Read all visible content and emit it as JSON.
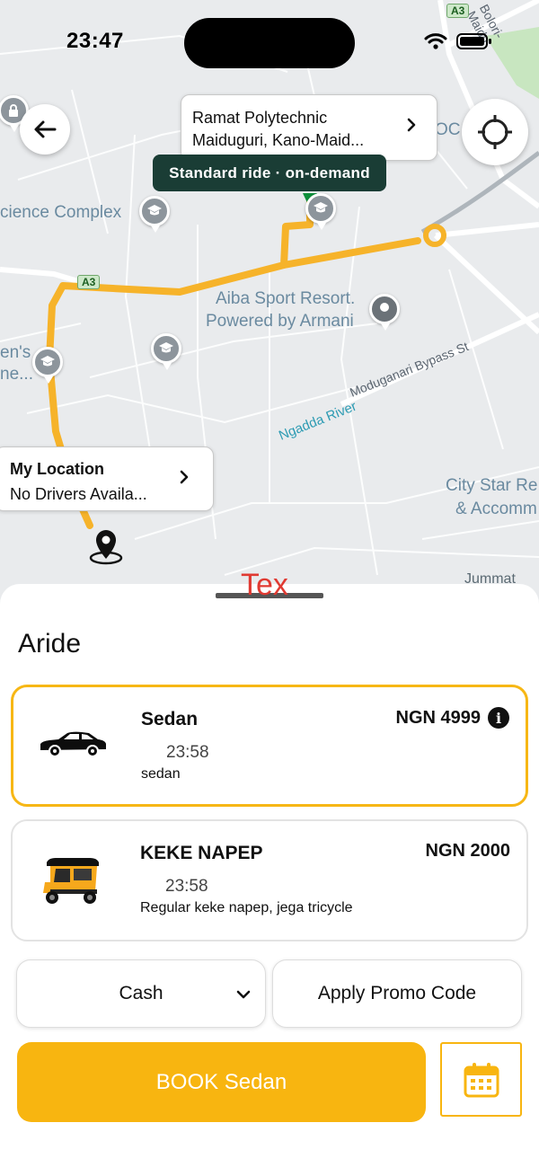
{
  "status_bar": {
    "time": "23:47"
  },
  "map": {
    "labels": {
      "science_complex": "cience Complex",
      "aiba_line1": "Aiba Sport Resort.",
      "aiba_line2": "Powered by Armani",
      "bypass": "Moduganari Bypass St",
      "river": "Ngadda River",
      "citystar_line1": "City Star Re",
      "citystar_line2": "& Accomm",
      "jummat": "Jummat",
      "ens_line1": "en's",
      "ens_line2": "ne...",
      "bolori": "Bolori-Maidu",
      "roc": "OC",
      "road_a3_top": "A3",
      "road_a3_left": "A3"
    },
    "destination": {
      "line1": "Ramat Polytechnic",
      "line2": "Maiduguri, Kano-Maid..."
    },
    "ride_tooltip": "Standard ride · on-demand",
    "my_location": {
      "title": "My Location",
      "subtitle": "No Drivers Availa..."
    }
  },
  "sheet": {
    "overlay_text": "Tex",
    "title": "Aride",
    "rides": [
      {
        "name": "Sedan",
        "time": "23:58",
        "description": "sedan",
        "price": "NGN 4999",
        "selected": true
      },
      {
        "name": "KEKE NAPEP",
        "time": "23:58",
        "description": "Regular keke napep, jega tricycle",
        "price": "NGN 2000",
        "selected": false
      }
    ],
    "payment_method": "Cash",
    "promo_label": "Apply Promo Code",
    "book_label": "BOOK Sedan"
  },
  "colors": {
    "accent": "#f8b510",
    "route": "#f6b32a",
    "tooltip_bg": "#1a3d35",
    "overlay_text": "#e03a32"
  }
}
